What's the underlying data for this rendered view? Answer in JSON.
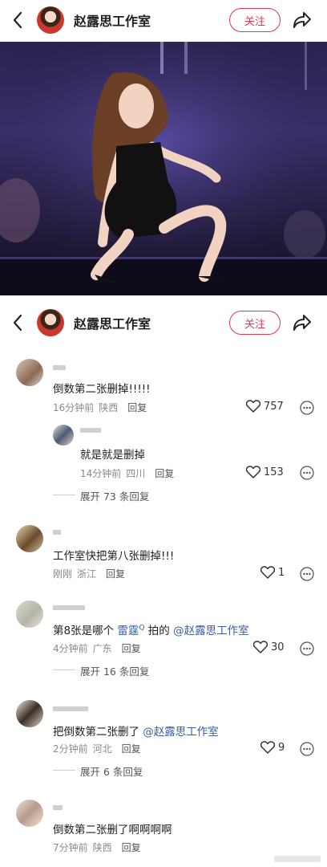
{
  "header": {
    "account_name": "赵露思工作室",
    "follow_label": "关注"
  },
  "comments": [
    {
      "text": "倒数第二张删掉!!!!!",
      "time": "16分钟前",
      "location": "陕西",
      "reply": "回复",
      "likes": "757"
    },
    {
      "text": "就是就是删掉",
      "time": "14分钟前",
      "location": "四川",
      "reply": "回复",
      "likes": "153"
    },
    {
      "expand": "展开 73 条回复"
    },
    {
      "text": "工作室快把第八张删掉!!!",
      "time": "刚刚",
      "location": "浙江",
      "reply": "回复",
      "likes": "1"
    },
    {
      "text_prefix": "第8张是哪个 ",
      "text_name": "雷霆",
      "text_mid": " 拍的 ",
      "text_mention": "@赵露思工作室",
      "time": "4分钟前",
      "location": "广东",
      "reply": "回复",
      "likes": "30"
    },
    {
      "expand": "展开 16 条回复"
    },
    {
      "text_prefix": "把倒数第二张删了 ",
      "text_mention": "@赵露思工作室",
      "time": "2分钟前",
      "location": "河北",
      "reply": "回复",
      "likes": "9"
    },
    {
      "expand": "展开 6 条回复"
    },
    {
      "text": "倒数第二张删了啊啊啊啊",
      "time": "7分钟前",
      "location": "陕西",
      "reply": "回复"
    }
  ],
  "icons": {
    "back": "chevron-left-icon",
    "share": "share-arrow-icon",
    "like": "heart-outline-icon",
    "more": "more-circle-icon",
    "name_tag": "search-superscript-icon"
  },
  "colors": {
    "accent": "#e0384e",
    "mention": "#3b5c9e",
    "meta": "#8a8a8a"
  }
}
